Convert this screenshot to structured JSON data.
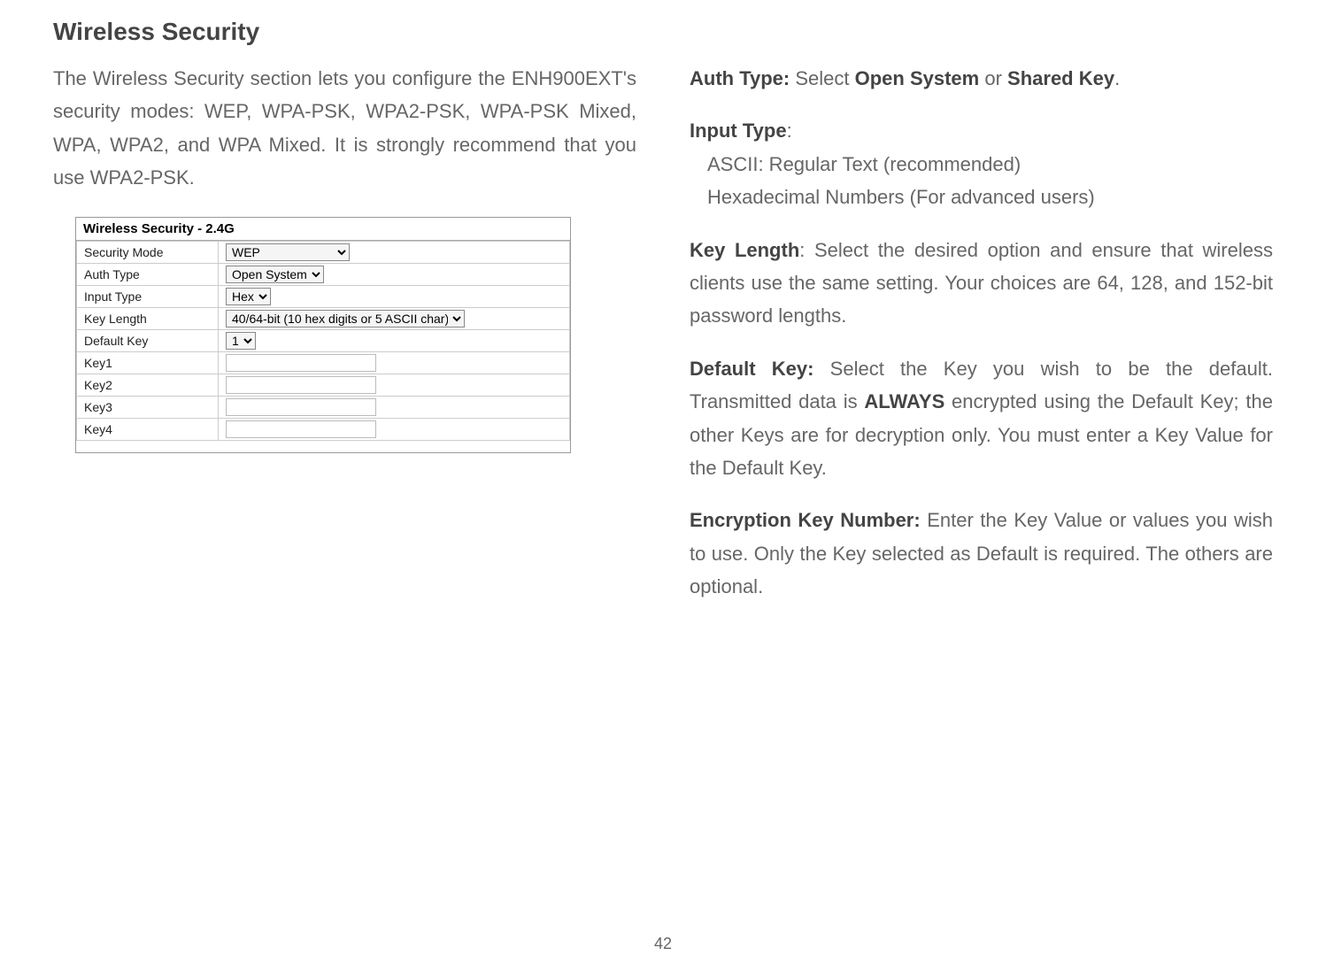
{
  "page_title": "Wireless Security",
  "lead_text": "The Wireless Security section lets you configure the ENH900EXT's security modes: WEP, WPA-PSK, WPA2-PSK, WPA-PSK Mixed, WPA, WPA2, and WPA Mixed. It is strongly recommend that you use WPA2-PSK.",
  "panel": {
    "title": "Wireless Security - 2.4G",
    "rows": {
      "security_mode": {
        "label": "Security Mode",
        "value": "WEP"
      },
      "auth_type": {
        "label": "Auth Type",
        "value": "Open System"
      },
      "input_type": {
        "label": "Input Type",
        "value": "Hex"
      },
      "key_length": {
        "label": "Key Length",
        "value": "40/64-bit (10 hex digits or 5 ASCII char)"
      },
      "default_key": {
        "label": "Default Key",
        "value": "1"
      },
      "key1": {
        "label": "Key1",
        "value": ""
      },
      "key2": {
        "label": "Key2",
        "value": ""
      },
      "key3": {
        "label": "Key3",
        "value": ""
      },
      "key4": {
        "label": "Key4",
        "value": ""
      }
    }
  },
  "right": {
    "auth_type_label": "Auth Type: ",
    "auth_type_text1": "Select ",
    "auth_type_bold1": "Open System",
    "auth_type_text2": " or ",
    "auth_type_bold2": "Shared Key",
    "auth_type_text3": ".",
    "input_type_label": "Input Type",
    "input_type_colon": ":",
    "input_type_line1": "ASCII: Regular Text (recommended)",
    "input_type_line2": "Hexadecimal Numbers (For advanced users)",
    "key_length_label": "Key Length",
    "key_length_text": ": Select the desired option and ensure that wireless clients use the same setting. Your choices are 64, 128, and 152-bit password lengths.",
    "default_key_label": "Default Key: ",
    "default_key_text1": "Select the Key you wish to be the default. Transmitted data is ",
    "default_key_bold": "ALWAYS",
    "default_key_text2": " encrypted using the Default Key; the other Keys are for decryption only. You must enter a Key Value for the Default Key.",
    "enc_key_label": "Encryption Key Number: ",
    "enc_key_text": "Enter the Key Value or values you wish to use. Only the Key selected as Default is required. The others are optional."
  },
  "page_number": "42"
}
